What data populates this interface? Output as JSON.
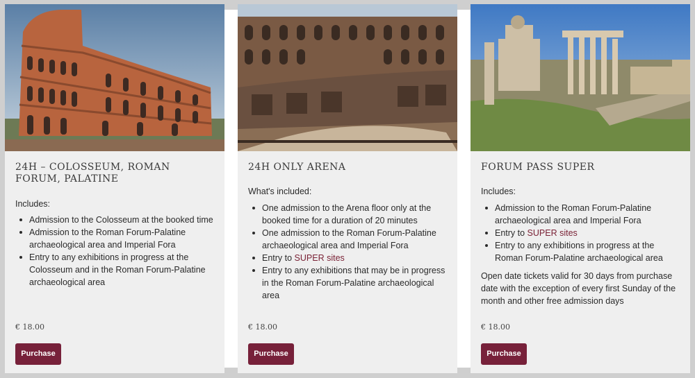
{
  "colors": {
    "accent": "#77213a",
    "link": "#7a2236",
    "card_bg": "#efefef",
    "overlay": "#8f8f8f"
  },
  "cards": [
    {
      "image_icon": "colosseum-photo",
      "title": "24h – Colosseum, Roman Forum, Palatine",
      "intro": "Includes:",
      "items": [
        "Admission to the Colosseum at the booked time",
        "Admission to the Roman Forum-Palatine archaeological area and Imperial Fora",
        "Entry to any exhibitions in progress at the Colosseum and in the Roman Forum-Palatine archaeological area"
      ],
      "price": "€ 18.00",
      "button": "Purchase"
    },
    {
      "image_icon": "arena-photo",
      "title": "24h only Arena",
      "intro": "What's included:",
      "items": [
        "One admission to the Arena floor only at the booked time for a duration of 20 minutes",
        "One admission to the Roman Forum-Palatine archaeological area and Imperial Fora",
        {
          "prefix": "Entry to ",
          "link": "SUPER sites"
        },
        "Entry to any exhibitions that may be in progress in the Roman Forum-Palatine archaeological area"
      ],
      "price": "€ 18.00",
      "button": "Purchase"
    },
    {
      "image_icon": "roman-forum-photo",
      "title": "Forum Pass SUPER",
      "intro": "Includes:",
      "items": [
        "Admission to the Roman Forum-Palatine archaeological area and Imperial Fora",
        {
          "prefix": "Entry to ",
          "link": "SUPER sites"
        },
        "Entry to any exhibitions in progress at the Roman Forum-Palatine archaeological area"
      ],
      "note": "Open date tickets valid for 30 days from purchase date with the exception of every first Sunday of the month and other free admission days",
      "price": "€ 18.00",
      "button": "Purchase"
    }
  ]
}
